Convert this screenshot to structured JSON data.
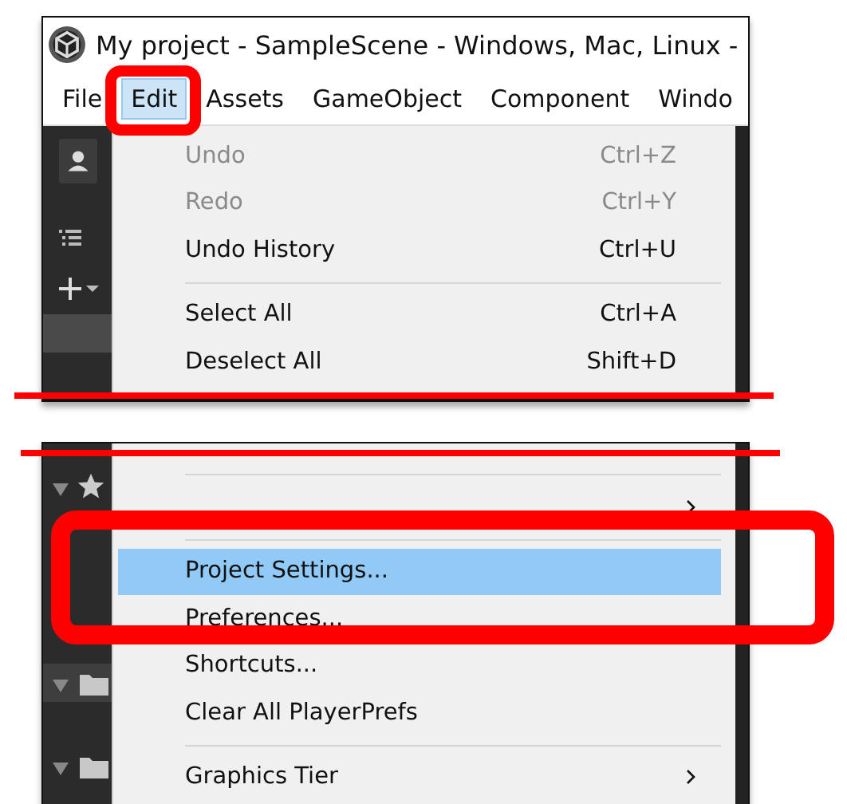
{
  "window": {
    "title": "My project - SampleScene - Windows, Mac, Linux -"
  },
  "menu_bar": [
    {
      "label": "File",
      "selected": false
    },
    {
      "label": "Edit",
      "selected": true
    },
    {
      "label": "Assets",
      "selected": false
    },
    {
      "label": "GameObject",
      "selected": false
    },
    {
      "label": "Component",
      "selected": false
    },
    {
      "label": "Windo",
      "selected": false
    }
  ],
  "edit_menu_top": [
    {
      "kind": "item",
      "label": "Undo",
      "shortcut": "Ctrl+Z",
      "disabled": true,
      "selected": false
    },
    {
      "kind": "item",
      "label": "Redo",
      "shortcut": "Ctrl+Y",
      "disabled": true,
      "selected": false
    },
    {
      "kind": "item",
      "label": "Undo History",
      "shortcut": "Ctrl+U",
      "disabled": false,
      "selected": false
    },
    {
      "kind": "separator"
    },
    {
      "kind": "item",
      "label": "Select All",
      "shortcut": "Ctrl+A",
      "disabled": false,
      "selected": false
    },
    {
      "kind": "item",
      "label": "Deselect All",
      "shortcut": "Shift+D",
      "disabled": false,
      "selected": false
    }
  ],
  "edit_menu_bottom": [
    {
      "kind": "separator"
    },
    {
      "kind": "submenu",
      "disabled": false,
      "selected": false
    },
    {
      "kind": "separator"
    },
    {
      "kind": "item",
      "label": "Project Settings...",
      "disabled": false,
      "selected": true
    },
    {
      "kind": "item",
      "label": "Preferences...",
      "disabled": false,
      "selected": false
    },
    {
      "kind": "item",
      "label": "Shortcuts...",
      "disabled": false,
      "selected": false
    },
    {
      "kind": "item",
      "label": "Clear All PlayerPrefs",
      "disabled": false,
      "selected": false
    },
    {
      "kind": "separator"
    },
    {
      "kind": "submenu",
      "label": "Graphics Tier",
      "disabled": false,
      "selected": false
    }
  ]
}
